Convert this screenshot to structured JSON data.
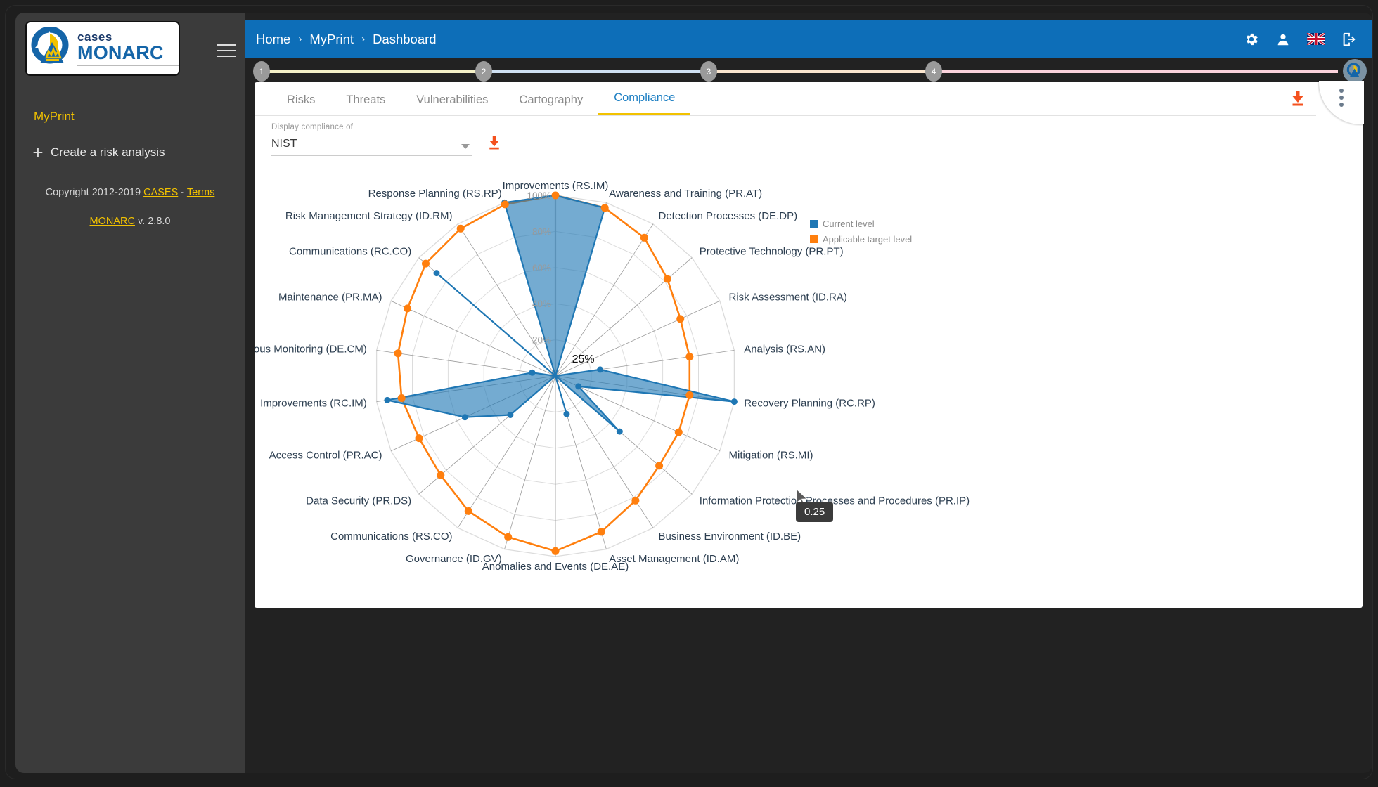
{
  "sidebar": {
    "logo": {
      "line1": "cases",
      "line2": "MONARC",
      "icon": "monarc-logo-icon"
    },
    "menu_icon": "hamburger-icon",
    "title": "MyPrint",
    "create": {
      "icon": "plus-icon",
      "label": "Create a risk analysis"
    },
    "copyright_prefix": "Copyright 2012-2019 ",
    "copyright_link": "CASES",
    "copyright_dash": " - ",
    "terms_link": "Terms",
    "version_link": "MONARC",
    "version_text": " v. 2.8.0"
  },
  "header": {
    "breadcrumb": [
      "Home",
      "MyPrint",
      "Dashboard"
    ],
    "separator": "›",
    "icons": [
      "gear-icon",
      "user-icon",
      "flag-uk-icon",
      "logout-icon"
    ],
    "bg_color": "#0d6eb8"
  },
  "steps": {
    "nodes": [
      "1",
      "2",
      "3",
      "4"
    ],
    "segment_colors": [
      "#f5f1c8",
      "#cfe0f2",
      "#fbe6cf",
      "#fbd2dc"
    ],
    "node_color": "#9a9a9a"
  },
  "tabs": [
    {
      "label": "Risks",
      "active": false
    },
    {
      "label": "Threats",
      "active": false
    },
    {
      "label": "Vulnerabilities",
      "active": false
    },
    {
      "label": "Cartography",
      "active": false
    },
    {
      "label": "Compliance",
      "active": true
    }
  ],
  "toolbar": {
    "download_icon": "download-icon",
    "kebab_icon": "more-vertical-icon",
    "accent": "#f2c200",
    "active_tab_color": "#1d7fc3"
  },
  "filter": {
    "label": "Display compliance of",
    "value": "NIST",
    "caret_icon": "chevron-down-icon",
    "download_icon": "download-icon"
  },
  "tooltip": {
    "value": "0.25",
    "point_label": "25%"
  },
  "chart_data": {
    "type": "radar",
    "title": "",
    "rlim": [
      0,
      100
    ],
    "rticks": [
      "20%",
      "40%",
      "60%",
      "80%",
      "100%"
    ],
    "grid": true,
    "legend_position": "top-right",
    "legend": [
      {
        "name": "Current level",
        "color": "#1f77b4"
      },
      {
        "name": "Applicable target level",
        "color": "#ff7f0e"
      }
    ],
    "categories": [
      "Improvements (RS.IM)",
      "Awareness and Training (PR.AT)",
      "Detection Processes (DE.DP)",
      "Protective Technology (PR.PT)",
      "Risk Assessment (ID.RA)",
      "Analysis (RS.AN)",
      "Recovery Planning (RC.RP)",
      "Mitigation (RS.MI)",
      "Information Protection Processes and Procedures (PR.IP)",
      "Business Environment (ID.BE)",
      "Asset Management (ID.AM)",
      "Anomalies and Events (DE.AE)",
      "Governance (ID.GV)",
      "Communications (RS.CO)",
      "Data Security (PR.DS)",
      "Access Control (PR.AC)",
      "Improvements (RC.IM)",
      "Security Continuous Monitoring (DE.CM)",
      "Maintenance (PR.MA)",
      "Communications (RC.CO)",
      "Risk Management Strategy (ID.RM)",
      "Response Planning (RS.RP)"
    ],
    "series": [
      {
        "name": "Current level",
        "color": "#1f77b4",
        "values": [
          100,
          97,
          0,
          0,
          0,
          25,
          100,
          14,
          47,
          0,
          22,
          0,
          0,
          0,
          33,
          55,
          94,
          13,
          0,
          87,
          0,
          100
        ]
      },
      {
        "name": "Applicable target level",
        "color": "#ff7f0e",
        "values": [
          100,
          97,
          91,
          82,
          76,
          75,
          75,
          75,
          76,
          82,
          90,
          97,
          93,
          89,
          84,
          83,
          86,
          88,
          90,
          95,
          97,
          99
        ]
      }
    ]
  }
}
